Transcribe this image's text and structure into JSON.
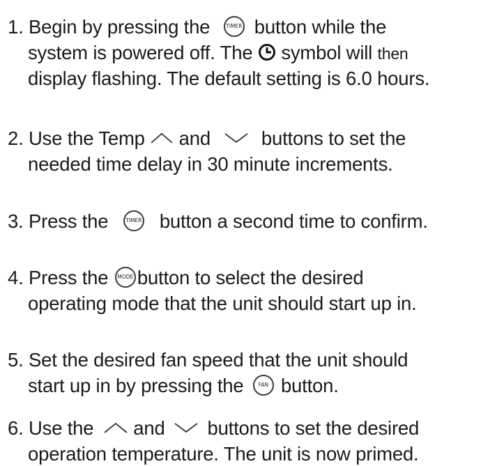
{
  "steps": [
    {
      "number": "1.",
      "l1a": "Begin by pressing the",
      "icon1": "TIMER",
      "l1b": "button while the",
      "l2a": "system is powered off. The",
      "clock_icon": "clock-icon",
      "l2b": "symbol will",
      "l2c": "then",
      "l3": "display flashing. The default setting is 6.0 hours."
    },
    {
      "number": "2.",
      "l1a": "Use the Temp",
      "l1b": "and",
      "l1c": "buttons to set the",
      "l2": "needed time delay in 30 minute increments."
    },
    {
      "number": "3.",
      "l1a": "Press the",
      "icon1": "TIMER",
      "l1b": "button a second time to confirm."
    },
    {
      "number": "4.",
      "l1a": "Press the",
      "icon1": "MODE",
      "l1b": "button to select the desired",
      "l2": "operating mode that the unit should start up in."
    },
    {
      "number": "5.",
      "l1": "Set the desired fan speed that the unit should",
      "l2a": "start up in by pressing the",
      "icon1": "FAN",
      "l2b": "button."
    },
    {
      "number": "6.",
      "l1a": "Use the",
      "l1b": "and",
      "l1c": "buttons to set the desired",
      "l2": "operation temperature. The unit is now primed."
    }
  ],
  "icons": {
    "up": "chevron-up-icon",
    "down": "chevron-down-icon",
    "button": "circle-button-icon"
  }
}
